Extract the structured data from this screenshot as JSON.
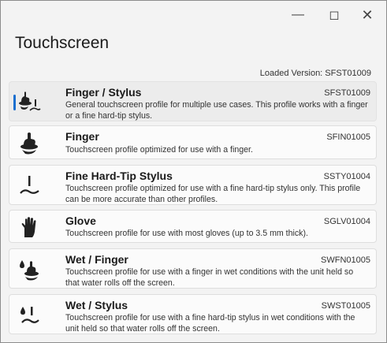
{
  "window": {
    "minimize_glyph": "—",
    "maximize_glyph": "◻",
    "close_glyph": "✕"
  },
  "page": {
    "title": "Touchscreen",
    "loaded_version": "Loaded Version: SFST01009"
  },
  "profiles": [
    {
      "title": "Finger / Stylus",
      "code": "SFST01009",
      "description": "General touchscreen profile for multiple use cases. This profile works with a finger or a fine hard-tip stylus.",
      "icon": "finger-stylus-icon",
      "selected": true
    },
    {
      "title": "Finger",
      "code": "SFIN01005",
      "description": "Touchscreen profile optimized for use with a finger.",
      "icon": "finger-icon",
      "selected": false
    },
    {
      "title": "Fine Hard-Tip Stylus",
      "code": "SSTY01004",
      "description": "Touchscreen profile optimized for use with a fine hard-tip stylus only. This profile can be more accurate than other profiles.",
      "icon": "stylus-icon",
      "selected": false
    },
    {
      "title": "Glove",
      "code": "SGLV01004",
      "description": "Touchscreen profile for use with most gloves (up to 3.5 mm thick).",
      "icon": "glove-icon",
      "selected": false
    },
    {
      "title": "Wet / Finger",
      "code": "SWFN01005",
      "description": "Touchscreen profile for use with a finger in wet conditions with the unit held so that water rolls off the screen.",
      "icon": "wet-finger-icon",
      "selected": false
    },
    {
      "title": "Wet / Stylus",
      "code": "SWST01005",
      "description": "Touchscreen profile for use with a fine hard-tip stylus in wet conditions with the unit held so that water rolls off the screen.",
      "icon": "wet-stylus-icon",
      "selected": false
    }
  ],
  "colors": {
    "accent": "#1a6fcf",
    "background": "#f3f3f3",
    "card": "#fbfbfb",
    "selected_card": "#ececec"
  }
}
